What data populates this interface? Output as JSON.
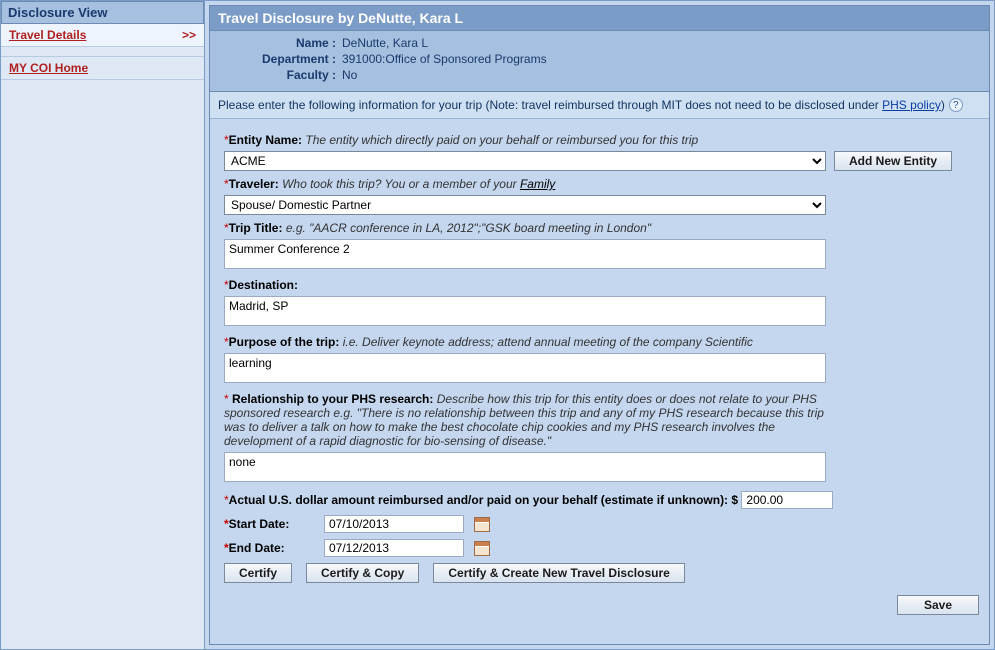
{
  "sidebar": {
    "header": "Disclosure View",
    "items": [
      {
        "label": "Travel Details",
        "arrow": ">>"
      },
      {
        "label": "MY COI Home",
        "arrow": ""
      }
    ]
  },
  "header": {
    "title": "Travel Disclosure by DeNutte, Kara L",
    "rows": [
      {
        "label": "Name :",
        "value": "DeNutte, Kara L"
      },
      {
        "label": "Department :",
        "value": "391000:Office of Sponsored Programs"
      },
      {
        "label": "Faculty :",
        "value": "No"
      }
    ]
  },
  "instruction": {
    "text_prefix": "Please enter the following information for your trip (Note: travel reimbursed through MIT does not need to be disclosed under ",
    "link": "PHS policy",
    "text_suffix": ")",
    "help": "?"
  },
  "form": {
    "entity": {
      "label": "Entity Name:",
      "hint": "The entity which directly paid on your behalf or reimbursed you for this trip",
      "value": "ACME",
      "add_button": "Add New Entity"
    },
    "traveler": {
      "label": "Traveler:",
      "hint_prefix": "Who took this trip? You or a member of your ",
      "hint_link": "Family",
      "value": "Spouse/ Domestic Partner"
    },
    "trip_title": {
      "label": "Trip Title:",
      "hint": "e.g. \"AACR conference in LA, 2012\";\"GSK board meeting in London\"",
      "value": "Summer Conference 2"
    },
    "destination": {
      "label": "Destination:",
      "value": "Madrid, SP"
    },
    "purpose": {
      "label": "Purpose of the trip:",
      "hint": "i.e. Deliver keynote address; attend annual meeting of the company Scientific",
      "value": "learning"
    },
    "relationship": {
      "label": " Relationship to your PHS research:",
      "hint": "Describe how this trip for this entity does or does not relate to your PHS sponsored research e.g. \"There is no relationship between this trip and any of my PHS research because this trip was to deliver a talk on how to make the best chocolate chip cookies and my PHS research involves the development of a rapid diagnostic for bio-sensing of disease.\"",
      "value": "none"
    },
    "amount": {
      "label": "Actual U.S. dollar amount reimbursed and/or paid on your behalf (estimate if unknown): $",
      "value": "200.00"
    },
    "start_date": {
      "label": "Start Date:",
      "value": "07/10/2013"
    },
    "end_date": {
      "label": "End Date:",
      "value": "07/12/2013"
    },
    "buttons": {
      "certify": "Certify",
      "certify_copy": "Certify & Copy",
      "certify_new": "Certify & Create  New Travel Disclosure",
      "save": "Save"
    }
  }
}
